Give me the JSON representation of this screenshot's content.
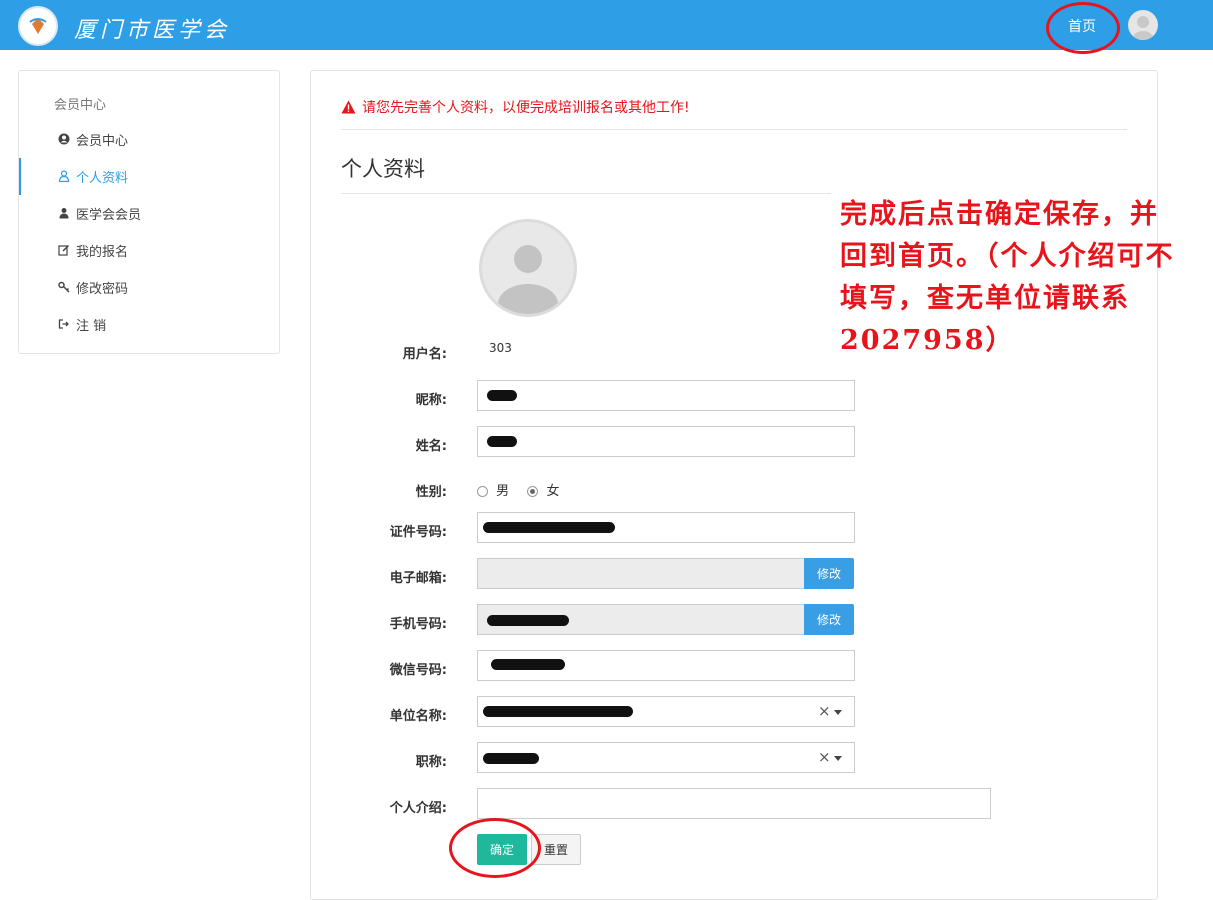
{
  "header": {
    "site_name": "厦门市医学会",
    "home_label": "首页"
  },
  "sidebar": {
    "title": "会员中心",
    "items": [
      {
        "label": "会员中心"
      },
      {
        "label": "个人资料"
      },
      {
        "label": "医学会会员"
      },
      {
        "label": "我的报名"
      },
      {
        "label": "修改密码"
      },
      {
        "label": "注 销"
      }
    ]
  },
  "main": {
    "warning": "请您先完善个人资料，以便完成培训报名或其他工作!",
    "title": "个人资料",
    "form": {
      "username_label": "用户名:",
      "username_value": "303",
      "nickname_label": "昵称:",
      "name_label": "姓名:",
      "gender_label": "性别:",
      "gender_male": "男",
      "gender_female": "女",
      "gender_selected": "女",
      "id_label": "证件号码:",
      "email_label": "电子邮箱:",
      "phone_label": "手机号码:",
      "wechat_label": "微信号码:",
      "unit_label": "单位名称:",
      "title_label": "职称:",
      "intro_label": "个人介绍:",
      "modify_label": "修改",
      "clear_symbol": "×",
      "ok_label": "确定",
      "reset_label": "重置"
    }
  },
  "annotation": {
    "note": "完成后点击确定保存，并回到首页。（个人介绍可不填写，查无单位请联系2027958）",
    "color": "#e8141b"
  },
  "colors": {
    "header_bg": "#2e9fe6",
    "accent": "#2e9fe6",
    "warning": "#e8141b",
    "ok_button": "#1fb89c",
    "modify_button": "#3a9ee4"
  }
}
